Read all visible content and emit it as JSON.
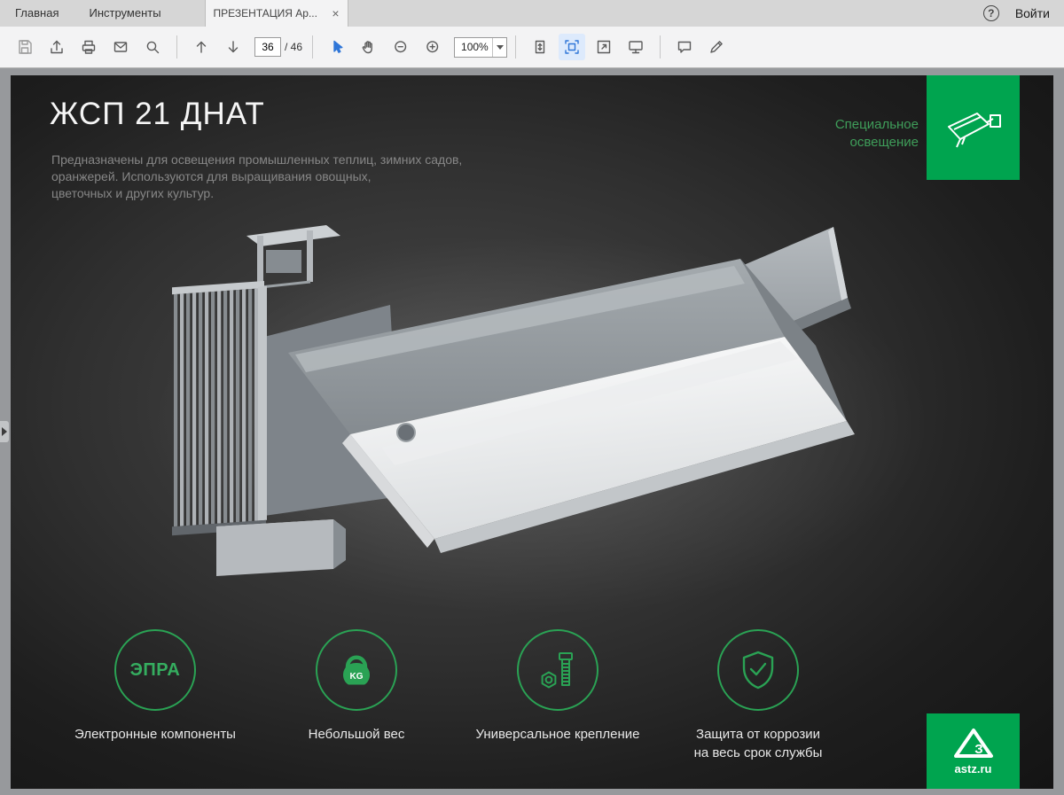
{
  "window": {
    "menu_tabs": [
      {
        "label": "Главная"
      },
      {
        "label": "Инструменты"
      }
    ],
    "document_tab": {
      "label": "ПРЕЗЕНТАЦИЯ Ар...",
      "close": "×"
    },
    "help": "?",
    "sign_in": "Войти"
  },
  "toolbar": {
    "page_current": "36",
    "page_total": "/ 46",
    "zoom": "100%",
    "icons": [
      "save",
      "share",
      "print",
      "email",
      "search",
      "previous-page",
      "next-page",
      "select-tool",
      "hand-tool",
      "zoom-out",
      "zoom-in",
      "fit-one-page",
      "fit-width",
      "fullscreen",
      "reading-mode",
      "comment",
      "draw"
    ]
  },
  "slide": {
    "title": "ЖСП 21 ДНАТ",
    "subtitle": [
      "Предназначены для освещения промышленных теплиц, зимних садов,",
      "оранжерей. Используются для выращивания овощных,",
      "цветочных и других культур."
    ],
    "category": [
      "Специальное",
      "освещение"
    ],
    "category_icon": "floodlight-line-art",
    "features": [
      {
        "icon": "epra-text",
        "icon_text": "ЭПРА",
        "label": "Электронные компоненты"
      },
      {
        "icon": "kettlebell-weight",
        "icon_text": "KG",
        "label": "Небольшой вес"
      },
      {
        "icon": "bolt-and-nut",
        "label": "Универсальное крепление"
      },
      {
        "icon": "shield-check",
        "label": "Защита от коррозии",
        "label2": "на весь срок службы"
      }
    ],
    "brand": "astz.ru",
    "brand_icon": "astz-triangle-logo"
  },
  "colors": {
    "accent_green": "#00a44f",
    "icon_green": "#2aa254",
    "selection_blue": "#2f76d8",
    "page_background": "#1e1e1e",
    "title_text": "#f5f5f5",
    "subtitle_text": "#878787"
  }
}
